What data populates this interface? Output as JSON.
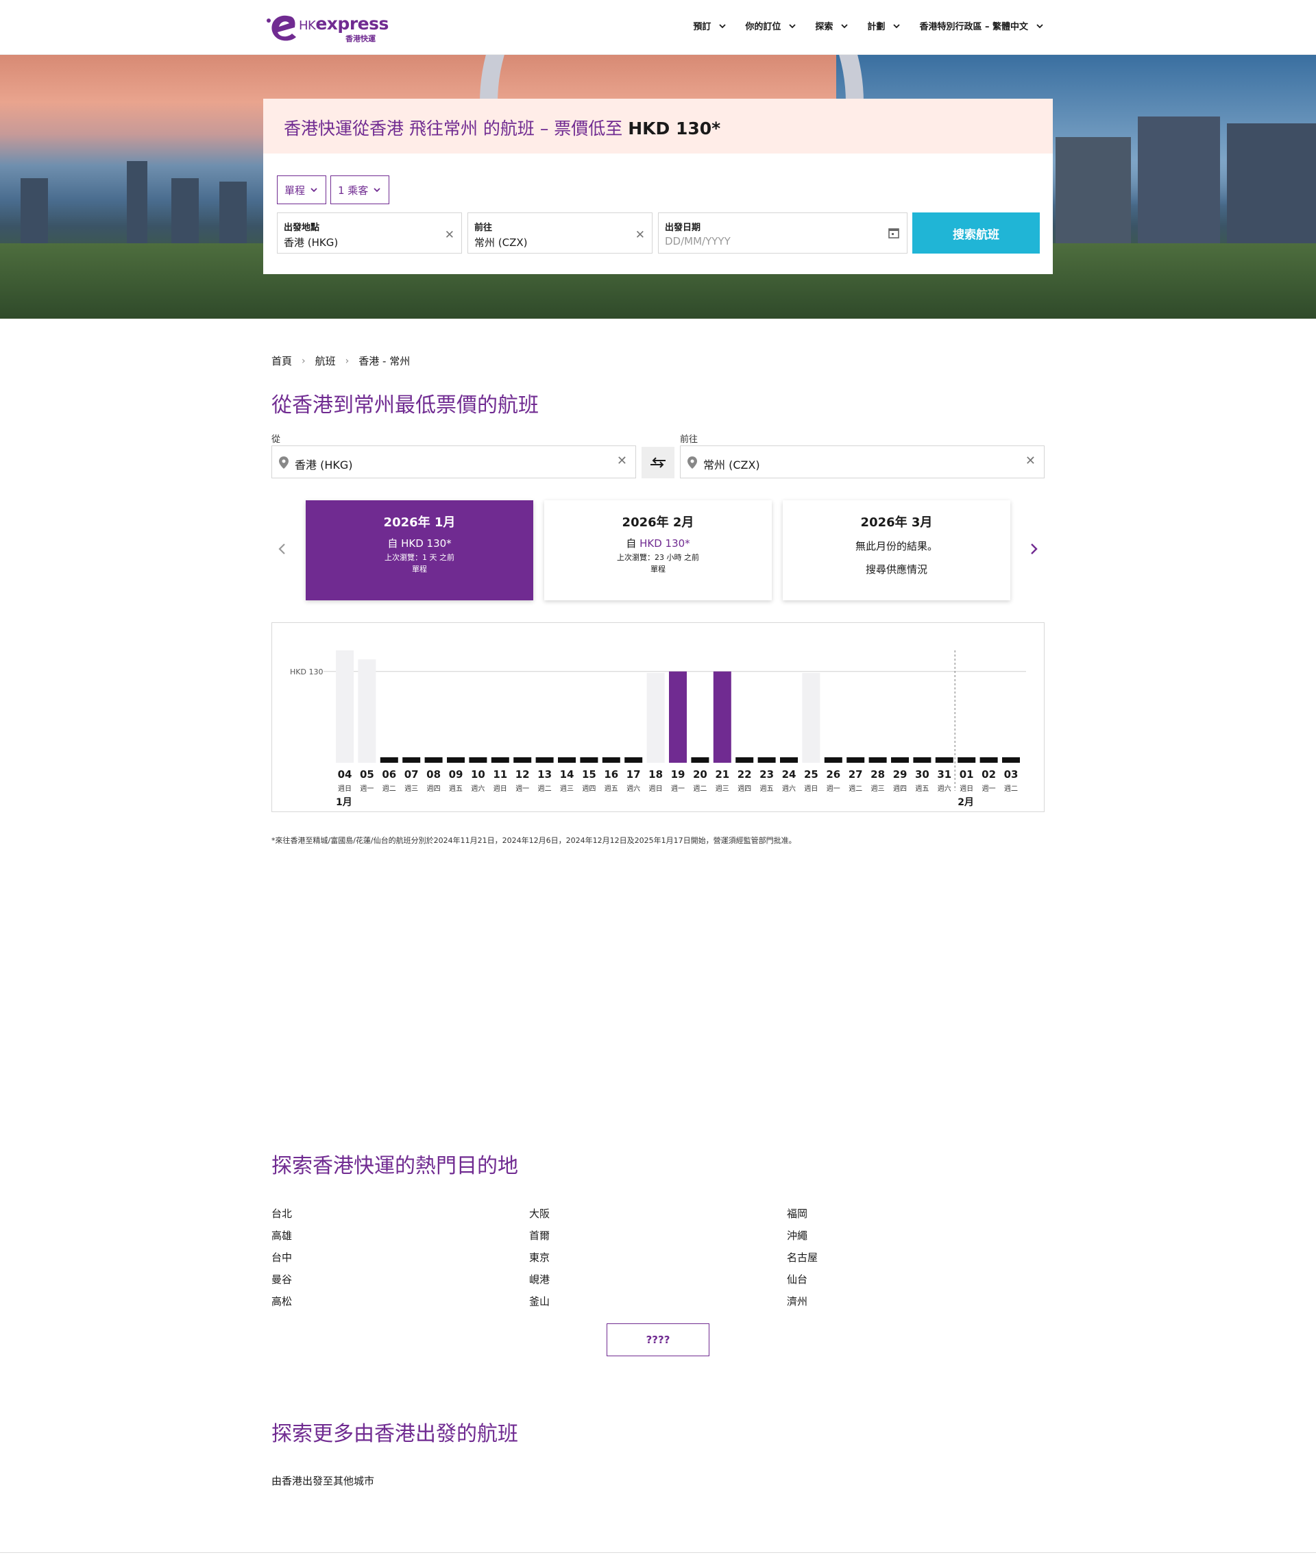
{
  "brand": {
    "logo_word": "express",
    "logo_prefix": "HK",
    "logo_sub": "香港快運",
    "accent": "#702b91",
    "cta_color": "#20b5d6"
  },
  "nav": [
    "預訂",
    "你的訂位",
    "探索",
    "計劃",
    "香港特別行政區 – 繁體中文"
  ],
  "hero": {
    "title_prefix": "香港快運從香港 飛往常州 的航班 – 票價低至",
    "title_price": "HKD 130*",
    "trip_type": "單程",
    "passengers": "1 乘客",
    "origin_label": "出發地點",
    "origin_value": "香港 (HKG)",
    "dest_label": "前往",
    "dest_value": "常州 (CZX)",
    "date_label": "出發日期",
    "date_placeholder": "DD/MM/YYYY",
    "search_label": "搜索航班"
  },
  "breadcrumb": [
    "首頁",
    "航班",
    "香港 - 常州"
  ],
  "page_title": "從香港到常州最低票價的航班",
  "route": {
    "from_label": "從",
    "from_value": "香港 (HKG)",
    "to_label": "前往",
    "to_value": "常州 (CZX)"
  },
  "months": [
    {
      "title": "2026年 1月",
      "price_prefix": "自",
      "price": "HKD 130*",
      "seen": "上次瀏覽：1 天 之前",
      "way": "單程",
      "active": true
    },
    {
      "title": "2026年 2月",
      "price_prefix": "自",
      "price": "HKD 130*",
      "seen": "上次瀏覽：23 小時 之前",
      "way": "單程",
      "active": false
    },
    {
      "title": "2026年 3月",
      "no_result": "無此月份的結果。",
      "availability": "搜尋供應情況",
      "active": false
    }
  ],
  "chart_data": {
    "type": "bar",
    "ylabel": "",
    "reference_label": "HKD 130",
    "reference_value": 130,
    "categories": [
      "04",
      "05",
      "06",
      "07",
      "08",
      "09",
      "10",
      "11",
      "12",
      "13",
      "14",
      "15",
      "16",
      "17",
      "18",
      "19",
      "20",
      "21",
      "22",
      "23",
      "24",
      "25",
      "26",
      "27",
      "28",
      "29",
      "30",
      "31",
      "01",
      "02",
      "03"
    ],
    "weekdays": [
      "週日",
      "週一",
      "週二",
      "週三",
      "週四",
      "週五",
      "週六",
      "週日",
      "週一",
      "週二",
      "週三",
      "週四",
      "週五",
      "週六",
      "週日",
      "週一",
      "週二",
      "週三",
      "週四",
      "週五",
      "週六",
      "週日",
      "週一",
      "週二",
      "週三",
      "週四",
      "週五",
      "週六",
      "週日",
      "週一",
      "週二"
    ],
    "month_markers": [
      {
        "index": 0,
        "label": "1月"
      },
      {
        "index": 28,
        "label": "2月"
      }
    ],
    "bar_kind": [
      "na",
      "na",
      "none",
      "none",
      "none",
      "none",
      "none",
      "none",
      "none",
      "none",
      "none",
      "none",
      "none",
      "none",
      "na",
      "fare",
      "none",
      "fare",
      "none",
      "none",
      "none",
      "na",
      "none",
      "none",
      "none",
      "none",
      "none",
      "none",
      "none",
      "none",
      "none"
    ],
    "values": [
      null,
      null,
      null,
      null,
      null,
      null,
      null,
      null,
      null,
      null,
      null,
      null,
      null,
      null,
      null,
      130,
      null,
      130,
      null,
      null,
      null,
      null,
      null,
      null,
      null,
      null,
      null,
      null,
      null,
      null,
      null
    ],
    "placeholder_heights": [
      1.0,
      0.92,
      0,
      0,
      0,
      0,
      0,
      0,
      0,
      0,
      0,
      0,
      0,
      0,
      0.8,
      0,
      0,
      0,
      0,
      0,
      0,
      0.8,
      0,
      0,
      0,
      0,
      0,
      0,
      0,
      0,
      0
    ],
    "colors": {
      "fare": "#702b91",
      "unavailable": "#f1f1f3",
      "no_flight": "#111111"
    }
  },
  "footnote": "*來往香港至精城/富國島/花蓮/仙台的航班分別於2024年11月21日，2024年12月6日，2024年12月12日及2025年1月17日開始，營運須經監管部門批准。",
  "popular": {
    "title": "探索香港快運的熱門目的地",
    "col1": [
      "台北",
      "高雄",
      "台中",
      "曼谷",
      "高松"
    ],
    "col2": [
      "大阪",
      "首爾",
      "東京",
      "峴港",
      "釜山"
    ],
    "col3": [
      "福岡",
      "沖繩",
      "名古屋",
      "仙台",
      "濟州"
    ],
    "more_label": "????"
  },
  "more_flights": {
    "title": "探索更多由香港出發的航班",
    "link": "由香港出發至其他城市"
  }
}
